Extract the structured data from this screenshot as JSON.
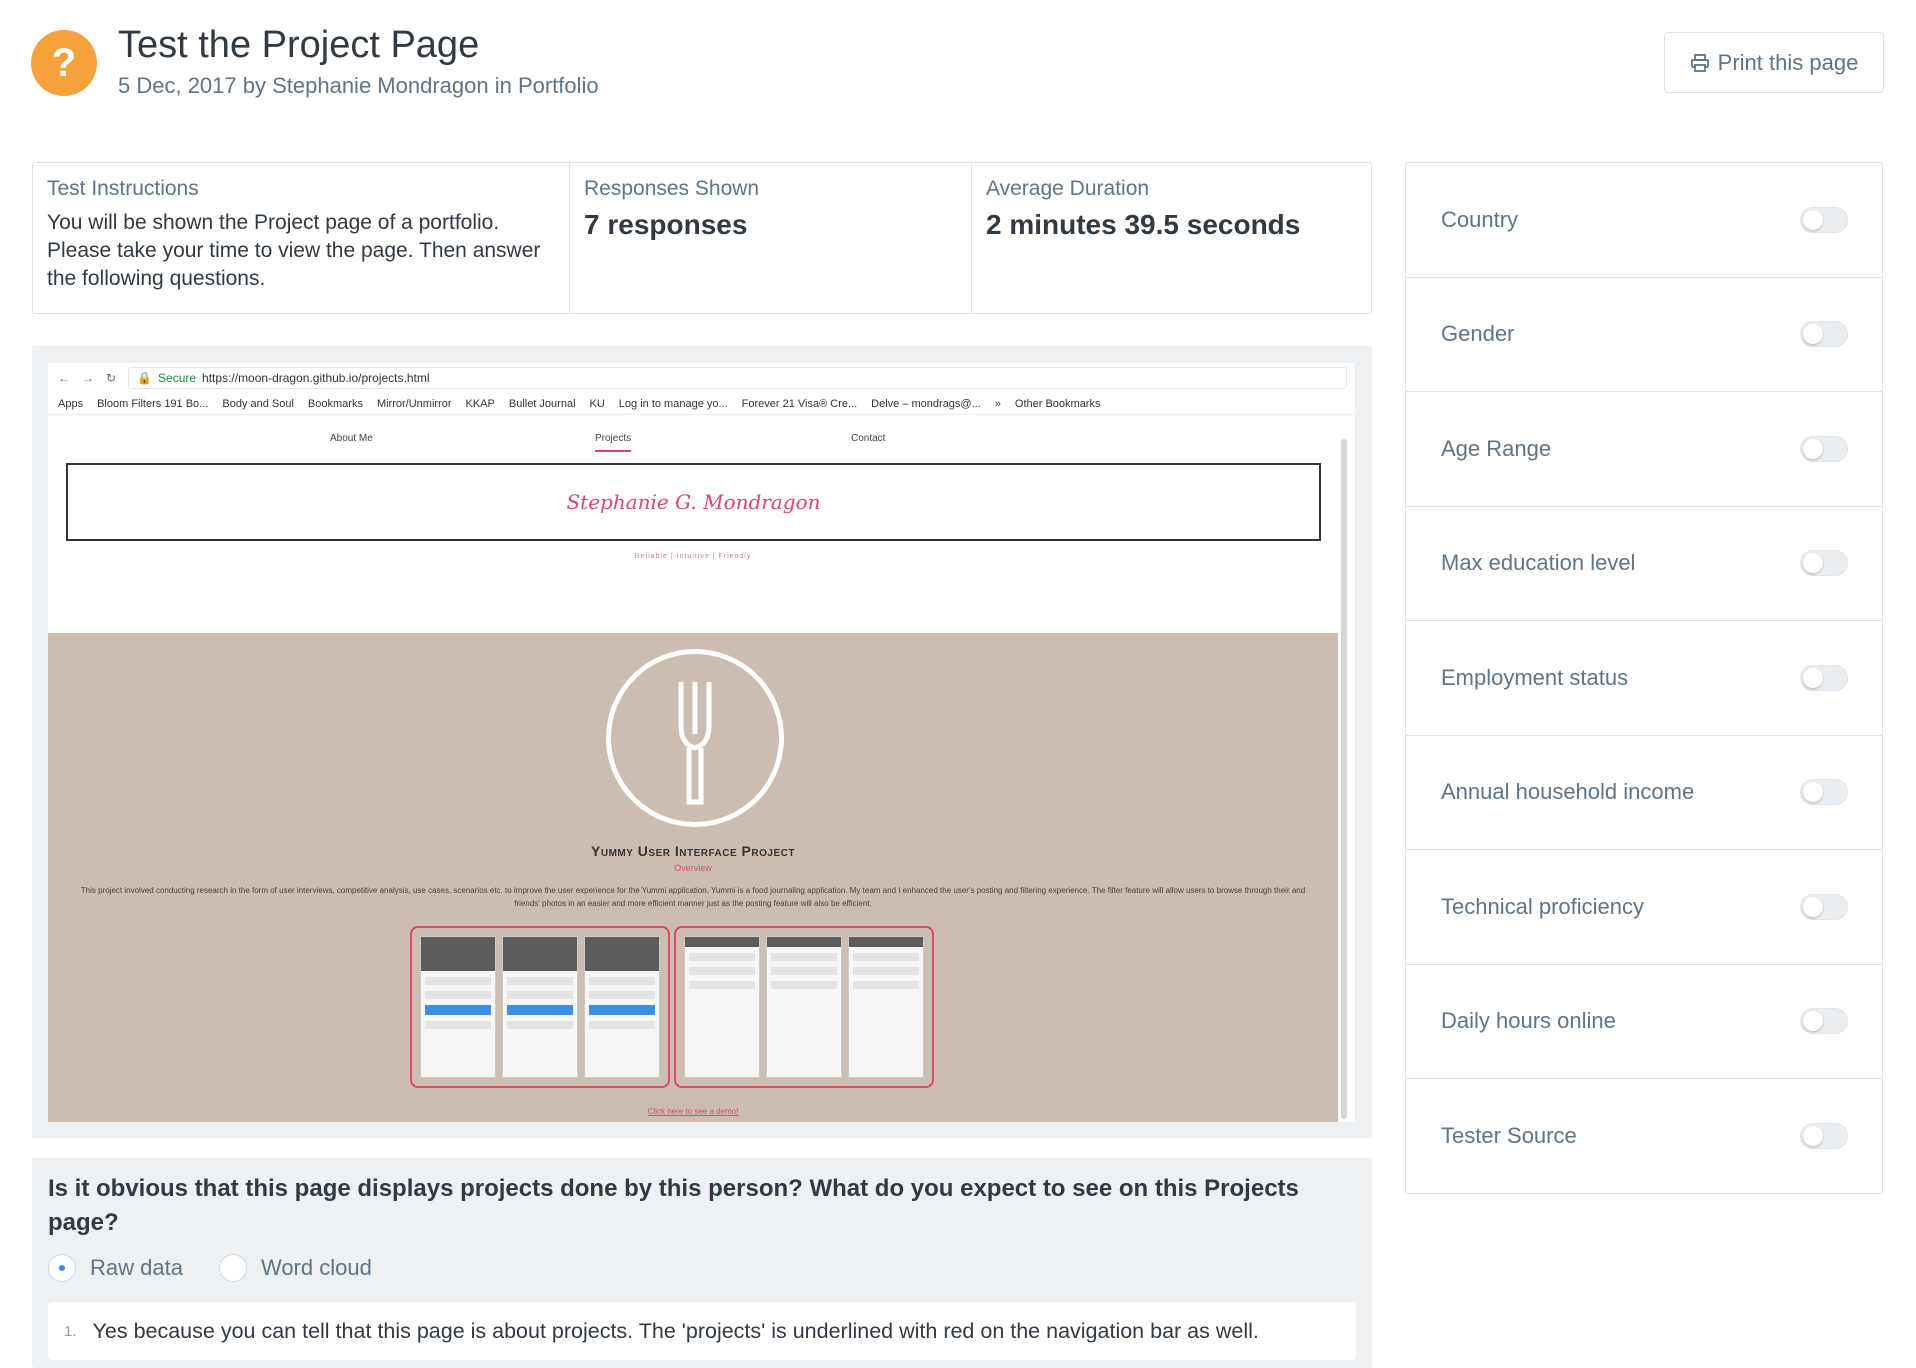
{
  "header": {
    "badge_icon": "?",
    "title": "Test the Project Page",
    "subtitle": "5 Dec, 2017 by Stephanie Mondragon in Portfolio",
    "print_label": "Print this page"
  },
  "stats": {
    "instructions_label": "Test Instructions",
    "instructions_text": "You will be shown the Project page of a portfolio. Please take your time to view the page. Then answer the following questions.",
    "responses_label": "Responses Shown",
    "responses_value": "7 responses",
    "duration_label": "Average Duration",
    "duration_value": "2 minutes 39.5 seconds"
  },
  "screenshot": {
    "secure_label": "Secure",
    "url": "https://moon-dragon.github.io/projects.html",
    "bookmarks": [
      "Apps",
      "Bloom Filters 191 Bo...",
      "Body and Soul",
      "Bookmarks",
      "Mirror/Unmirror",
      "KKAP",
      "Bullet Journal",
      "KU",
      "Log in to manage yo...",
      "Forever 21 Visa® Cre...",
      "Delve – mondrags@...",
      "»",
      "Other Bookmarks"
    ],
    "nav": [
      "About Me",
      "Projects",
      "Contact"
    ],
    "site_name": "Stephanie G. Mondragon",
    "tagline": "Reliable | Intuitive | Friendly",
    "project_title": "Yummy User Interface Project",
    "overview_label": "Overview",
    "description": "This project involved conducting research in the form of user interviews, competitive analysis, use cases, scenarios etc. to improve the user experience for the Yummi application. Yummi is a food journaling application. My team and I enhanced the user's posting and filtering experience. The filter feature will allow users to browse through their and friends' photos in an easier and more efficient manner just as the posting feature will also be efficient.",
    "demo_link": "Click here to see a demo!"
  },
  "question": {
    "text": "Is it obvious that this page displays projects done by this person? What do you expect to see on this Projects page?",
    "options": [
      "Raw data",
      "Word cloud"
    ],
    "selected": "Raw data",
    "responses": [
      {
        "number": "1.",
        "text": "Yes because you can tell that this page is about projects. The 'projects' is underlined with red on the navigation bar as well."
      }
    ]
  },
  "filters": [
    {
      "label": "Country",
      "on": false
    },
    {
      "label": "Gender",
      "on": false
    },
    {
      "label": "Age Range",
      "on": false
    },
    {
      "label": "Max education level",
      "on": false
    },
    {
      "label": "Employment status",
      "on": false
    },
    {
      "label": "Annual household income",
      "on": false
    },
    {
      "label": "Technical proficiency",
      "on": false
    },
    {
      "label": "Daily hours online",
      "on": false
    },
    {
      "label": "Tester Source",
      "on": false
    }
  ],
  "colors": {
    "accent_orange": "#f5a13c",
    "text_muted": "#5d7489",
    "link_pink": "#e0456b",
    "radio_blue": "#3a8ee6"
  }
}
